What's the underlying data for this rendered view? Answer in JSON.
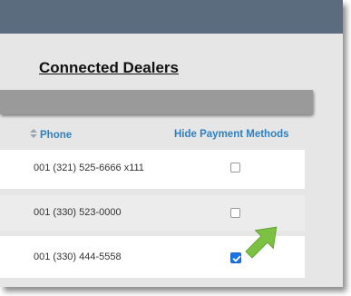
{
  "page": {
    "title": "Connected Dealers"
  },
  "table": {
    "columns": {
      "phone": "Phone",
      "hide_payment_methods": "Hide Payment Methods"
    },
    "rows": [
      {
        "phone": "001 (321) 525-6666 x111",
        "hide_payment_methods": false
      },
      {
        "phone": "001 (330) 523-0000",
        "hide_payment_methods": false
      },
      {
        "phone": "001 (330) 444-5558",
        "hide_payment_methods": true
      }
    ]
  },
  "colors": {
    "topbar": "#5a6c7d",
    "header_link": "#2f7fc1",
    "checkbox_checked": "#1a73e8",
    "annotation_arrow": "#7cc142"
  },
  "icons": {
    "sort": "sort-arrows-icon",
    "check": "checkmark-icon",
    "annotation": "green-arrow-icon"
  }
}
